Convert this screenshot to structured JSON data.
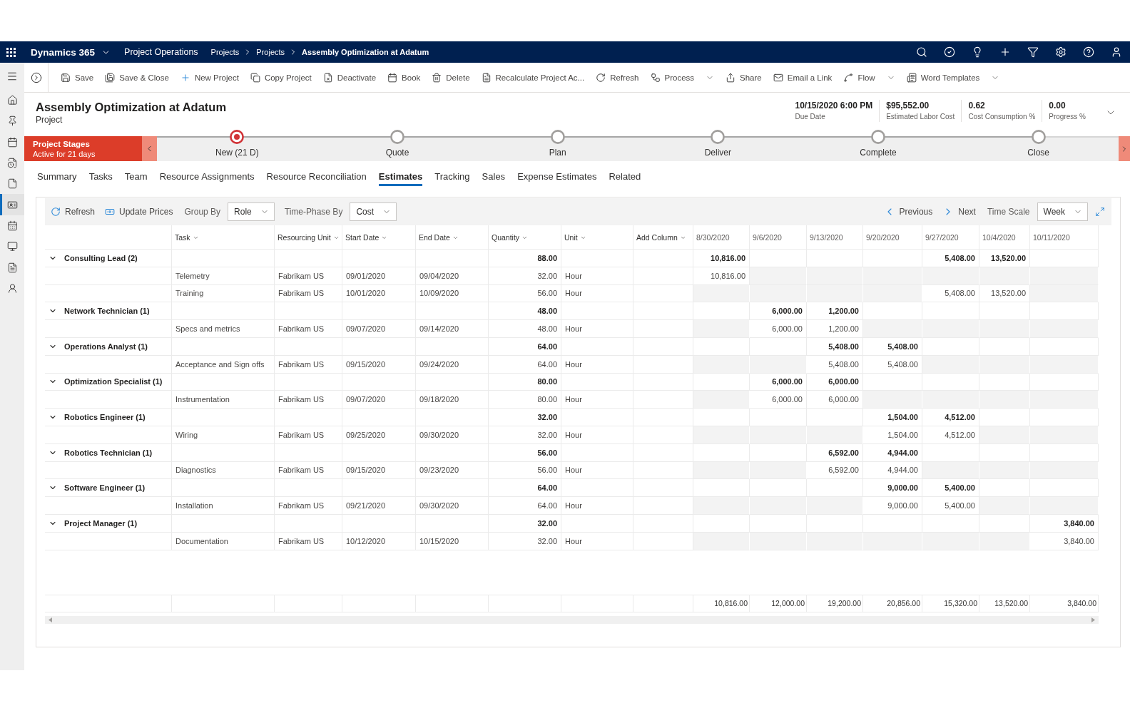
{
  "top_bar": {
    "app_name": "Dynamics 365",
    "area": "Project Operations",
    "breadcrumbs": [
      "Projects",
      "Projects",
      "Assembly Optimization at Adatum"
    ]
  },
  "nav_rail": {
    "items": [
      {
        "selected": false
      },
      {
        "selected": false
      },
      {
        "selected": false
      },
      {
        "selected": false
      },
      {
        "selected": false
      },
      {
        "selected": true
      },
      {
        "selected": false
      },
      {
        "selected": false
      },
      {
        "selected": false
      },
      {
        "selected": false
      }
    ]
  },
  "command_bar": {
    "items": [
      {
        "label": "Save",
        "menu": false
      },
      {
        "label": "Save & Close",
        "menu": false
      },
      {
        "label": "New Project",
        "menu": false
      },
      {
        "label": "Copy Project",
        "menu": false
      },
      {
        "label": "Deactivate",
        "menu": false
      },
      {
        "label": "Book",
        "menu": false
      },
      {
        "label": "Delete",
        "menu": false
      },
      {
        "label": "Recalculate Project Ac...",
        "menu": false
      },
      {
        "label": "Refresh",
        "menu": false
      },
      {
        "label": "Process",
        "menu": true
      },
      {
        "label": "Share",
        "menu": false
      },
      {
        "label": "Email a Link",
        "menu": false
      },
      {
        "label": "Flow",
        "menu": true
      },
      {
        "label": "Word Templates",
        "menu": true
      }
    ]
  },
  "header": {
    "title": "Assembly Optimization at Adatum",
    "entity": "Project",
    "fields": [
      {
        "value": "10/15/2020 6:00 PM",
        "label": "Due Date"
      },
      {
        "value": "$95,552.00",
        "label": "Estimated Labor Cost"
      },
      {
        "value": "0.62",
        "label": "Cost Consumption %"
      },
      {
        "value": "0.00",
        "label": "Progress %"
      }
    ]
  },
  "business_process": {
    "title": "Project Stages",
    "status": "Active for 21 days",
    "stages": [
      {
        "label": "New (21 D)",
        "selected": true
      },
      {
        "label": "Quote",
        "selected": false
      },
      {
        "label": "Plan",
        "selected": false
      },
      {
        "label": "Deliver",
        "selected": false
      },
      {
        "label": "Complete",
        "selected": false
      },
      {
        "label": "Close",
        "selected": false
      }
    ]
  },
  "tabs": [
    {
      "label": "Summary",
      "selected": false
    },
    {
      "label": "Tasks",
      "selected": false
    },
    {
      "label": "Team",
      "selected": false
    },
    {
      "label": "Resource Assignments",
      "selected": false
    },
    {
      "label": "Resource Reconciliation",
      "selected": false
    },
    {
      "label": "Estimates",
      "selected": true
    },
    {
      "label": "Tracking",
      "selected": false
    },
    {
      "label": "Sales",
      "selected": false
    },
    {
      "label": "Expense Estimates",
      "selected": false
    },
    {
      "label": "Related",
      "selected": false
    }
  ],
  "estimates": {
    "toolbar": {
      "actions": [
        "Refresh",
        "Update Prices"
      ],
      "group_by": {
        "label": "Group By",
        "value": "Role"
      },
      "time_phase_by": {
        "label": "Time-Phase By",
        "value": "Cost"
      },
      "navigation": [
        "Previous",
        "Next"
      ],
      "time_scale": {
        "label": "Time Scale",
        "value": "Week"
      }
    },
    "columns": [
      "Task",
      "Resourcing Unit",
      "Start Date",
      "End Date",
      "Quantity",
      "Unit",
      "Add Column"
    ],
    "periods": [
      "8/30/2020",
      "9/6/2020",
      "9/13/2020",
      "9/20/2020",
      "9/27/2020",
      "10/4/2020",
      "10/11/2020"
    ],
    "groups": [
      {
        "name": "Consulting Lead (2)",
        "expanded": true,
        "quantity": "88.00",
        "amounts": [
          {
            "value": "10,816.00",
            "shaded": false
          },
          {
            "shaded": false
          },
          {
            "shaded": false
          },
          {
            "shaded": false
          },
          {
            "value": "5,408.00",
            "shaded": false
          },
          {
            "value": "13,520.00",
            "shaded": false
          },
          {
            "shaded": false
          }
        ],
        "children": [
          {
            "task": "Telemetry",
            "resourcing_unit": "Fabrikam US",
            "start_date": "09/01/2020",
            "end_date": "09/04/2020",
            "quantity": "32.00",
            "unit": "Hour",
            "amounts": [
              {
                "value": "10,816.00",
                "shaded": false
              },
              {
                "shaded": true
              },
              {
                "shaded": true
              },
              {
                "shaded": true
              },
              {
                "shaded": true
              },
              {
                "shaded": true
              },
              {
                "shaded": true
              }
            ]
          },
          {
            "task": "Training",
            "resourcing_unit": "Fabrikam US",
            "start_date": "10/01/2020",
            "end_date": "10/09/2020",
            "quantity": "56.00",
            "unit": "Hour",
            "amounts": [
              {
                "shaded": true
              },
              {
                "shaded": true
              },
              {
                "shaded": true
              },
              {
                "shaded": true
              },
              {
                "value": "5,408.00",
                "shaded": false
              },
              {
                "value": "13,520.00",
                "shaded": false
              },
              {
                "shaded": true
              }
            ]
          }
        ]
      },
      {
        "name": "Network Technician (1)",
        "expanded": true,
        "quantity": "48.00",
        "amounts": [
          {
            "shaded": false
          },
          {
            "value": "6,000.00",
            "shaded": false
          },
          {
            "value": "1,200.00",
            "shaded": false
          },
          {
            "shaded": false
          },
          {
            "shaded": false
          },
          {
            "shaded": false
          },
          {
            "shaded": false
          }
        ],
        "children": [
          {
            "task": "Specs and metrics",
            "resourcing_unit": "Fabrikam US",
            "start_date": "09/07/2020",
            "end_date": "09/14/2020",
            "quantity": "48.00",
            "unit": "Hour",
            "amounts": [
              {
                "shaded": true
              },
              {
                "value": "6,000.00",
                "shaded": false
              },
              {
                "value": "1,200.00",
                "shaded": false
              },
              {
                "shaded": true
              },
              {
                "shaded": true
              },
              {
                "shaded": true
              },
              {
                "shaded": true
              }
            ]
          }
        ]
      },
      {
        "name": "Operations Analyst (1)",
        "expanded": true,
        "quantity": "64.00",
        "amounts": [
          {
            "shaded": false
          },
          {
            "shaded": false
          },
          {
            "value": "5,408.00",
            "shaded": false
          },
          {
            "value": "5,408.00",
            "shaded": false
          },
          {
            "shaded": false
          },
          {
            "shaded": false
          },
          {
            "shaded": false
          }
        ],
        "children": [
          {
            "task": "Acceptance and Sign offs",
            "resourcing_unit": "Fabrikam US",
            "start_date": "09/15/2020",
            "end_date": "09/24/2020",
            "quantity": "64.00",
            "unit": "Hour",
            "amounts": [
              {
                "shaded": true
              },
              {
                "shaded": true
              },
              {
                "value": "5,408.00",
                "shaded": false
              },
              {
                "value": "5,408.00",
                "shaded": false
              },
              {
                "shaded": true
              },
              {
                "shaded": true
              },
              {
                "shaded": true
              }
            ]
          }
        ]
      },
      {
        "name": "Optimization Specialist (1)",
        "expanded": true,
        "quantity": "80.00",
        "amounts": [
          {
            "shaded": false
          },
          {
            "value": "6,000.00",
            "shaded": false
          },
          {
            "value": "6,000.00",
            "shaded": false
          },
          {
            "shaded": false
          },
          {
            "shaded": false
          },
          {
            "shaded": false
          },
          {
            "shaded": false
          }
        ],
        "children": [
          {
            "task": "Instrumentation",
            "resourcing_unit": "Fabrikam US",
            "start_date": "09/07/2020",
            "end_date": "09/18/2020",
            "quantity": "80.00",
            "unit": "Hour",
            "amounts": [
              {
                "shaded": true
              },
              {
                "value": "6,000.00",
                "shaded": false
              },
              {
                "value": "6,000.00",
                "shaded": false
              },
              {
                "shaded": true
              },
              {
                "shaded": true
              },
              {
                "shaded": true
              },
              {
                "shaded": true
              }
            ]
          }
        ]
      },
      {
        "name": "Robotics Engineer (1)",
        "expanded": true,
        "quantity": "32.00",
        "amounts": [
          {
            "shaded": false
          },
          {
            "shaded": false
          },
          {
            "shaded": false
          },
          {
            "value": "1,504.00",
            "shaded": false
          },
          {
            "value": "4,512.00",
            "shaded": false
          },
          {
            "shaded": false
          },
          {
            "shaded": false
          }
        ],
        "children": [
          {
            "task": "Wiring",
            "resourcing_unit": "Fabrikam US",
            "start_date": "09/25/2020",
            "end_date": "09/30/2020",
            "quantity": "32.00",
            "unit": "Hour",
            "amounts": [
              {
                "shaded": true
              },
              {
                "shaded": true
              },
              {
                "shaded": true
              },
              {
                "value": "1,504.00",
                "shaded": false
              },
              {
                "value": "4,512.00",
                "shaded": false
              },
              {
                "shaded": true
              },
              {
                "shaded": true
              }
            ]
          }
        ]
      },
      {
        "name": "Robotics Technician (1)",
        "expanded": true,
        "quantity": "56.00",
        "amounts": [
          {
            "shaded": false
          },
          {
            "shaded": false
          },
          {
            "value": "6,592.00",
            "shaded": false
          },
          {
            "value": "4,944.00",
            "shaded": false
          },
          {
            "shaded": false
          },
          {
            "shaded": false
          },
          {
            "shaded": false
          }
        ],
        "children": [
          {
            "task": "Diagnostics",
            "resourcing_unit": "Fabrikam US",
            "start_date": "09/15/2020",
            "end_date": "09/23/2020",
            "quantity": "56.00",
            "unit": "Hour",
            "amounts": [
              {
                "shaded": true
              },
              {
                "shaded": true
              },
              {
                "value": "6,592.00",
                "shaded": false
              },
              {
                "value": "4,944.00",
                "shaded": false
              },
              {
                "shaded": true
              },
              {
                "shaded": true
              },
              {
                "shaded": true
              }
            ]
          }
        ]
      },
      {
        "name": "Software Engineer (1)",
        "expanded": true,
        "quantity": "64.00",
        "amounts": [
          {
            "shaded": false
          },
          {
            "shaded": false
          },
          {
            "shaded": false
          },
          {
            "value": "9,000.00",
            "shaded": false
          },
          {
            "value": "5,400.00",
            "shaded": false
          },
          {
            "shaded": false
          },
          {
            "shaded": false
          }
        ],
        "children": [
          {
            "task": "Installation",
            "resourcing_unit": "Fabrikam US",
            "start_date": "09/21/2020",
            "end_date": "09/30/2020",
            "quantity": "64.00",
            "unit": "Hour",
            "amounts": [
              {
                "shaded": true
              },
              {
                "shaded": true
              },
              {
                "shaded": true
              },
              {
                "value": "9,000.00",
                "shaded": false
              },
              {
                "value": "5,400.00",
                "shaded": false
              },
              {
                "shaded": true
              },
              {
                "shaded": true
              }
            ]
          }
        ]
      },
      {
        "name": "Project Manager (1)",
        "expanded": true,
        "quantity": "32.00",
        "amounts": [
          {
            "shaded": false
          },
          {
            "shaded": false
          },
          {
            "shaded": false
          },
          {
            "shaded": false
          },
          {
            "shaded": false
          },
          {
            "shaded": false
          },
          {
            "value": "3,840.00",
            "shaded": false
          }
        ],
        "children": [
          {
            "task": "Documentation",
            "resourcing_unit": "Fabrikam US",
            "start_date": "10/12/2020",
            "end_date": "10/15/2020",
            "quantity": "32.00",
            "unit": "Hour",
            "amounts": [
              {
                "shaded": true
              },
              {
                "shaded": true
              },
              {
                "shaded": true
              },
              {
                "shaded": true
              },
              {
                "shaded": true
              },
              {
                "shaded": true
              },
              {
                "value": "3,840.00",
                "shaded": false
              }
            ]
          }
        ]
      }
    ],
    "totals": [
      "10,816.00",
      "12,000.00",
      "19,200.00",
      "20,856.00",
      "15,320.00",
      "13,520.00",
      "3,840.00"
    ]
  }
}
